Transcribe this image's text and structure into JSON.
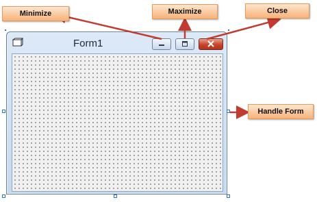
{
  "form": {
    "title": "Form1",
    "icon": "form-window-icon",
    "buttons": {
      "minimize": "minimize-icon",
      "maximize": "maximize-icon",
      "close": "close-icon"
    }
  },
  "callouts": {
    "minimize": "Minimize",
    "maximize": "Maximize",
    "close": "Close",
    "handle_form": "Handle Form"
  },
  "colors": {
    "callout_fill": "#f7b27a",
    "arrow": "#c23b30",
    "handle_border": "#2c6fd6",
    "close_button": "#c6442b"
  }
}
